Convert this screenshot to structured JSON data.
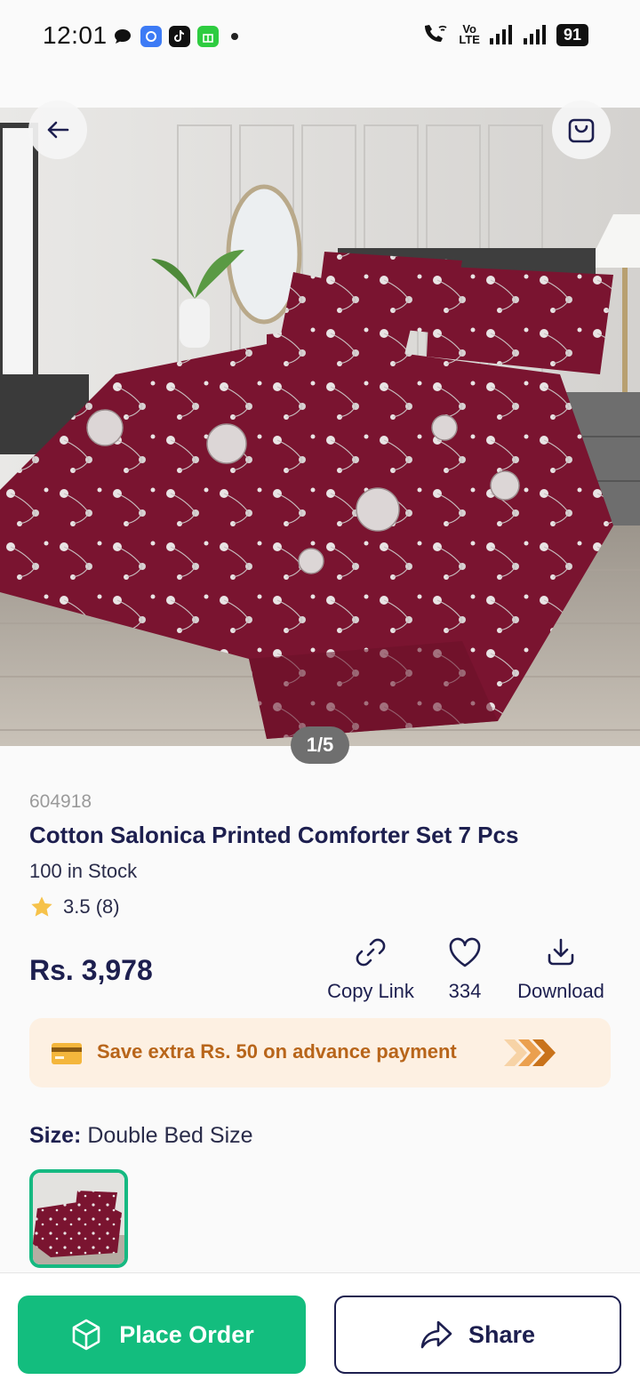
{
  "status_bar": {
    "time": "12:01",
    "volte_top": "Vo",
    "volte_bottom": "LTE",
    "battery": "91"
  },
  "gallery": {
    "pager": "1/5"
  },
  "product": {
    "sku": "604918",
    "title": "Cotton Salonica Printed Comforter Set 7 Pcs",
    "stock": "100 in Stock",
    "rating": "3.5 (8)",
    "price": "Rs. 3,978"
  },
  "actions": {
    "copy_link": "Copy Link",
    "likes": "334",
    "download": "Download"
  },
  "promo": {
    "text": "Save extra Rs. 50 on advance payment"
  },
  "size": {
    "label": "Size:",
    "value": "Double Bed Size"
  },
  "bottom_bar": {
    "place_order": "Place Order",
    "share": "Share"
  },
  "colors": {
    "primary_green": "#13bd7e",
    "navy": "#1d1f4f",
    "promo_bg": "#fdf0e2",
    "promo_text": "#b8651a",
    "fabric": "#7a1430"
  }
}
